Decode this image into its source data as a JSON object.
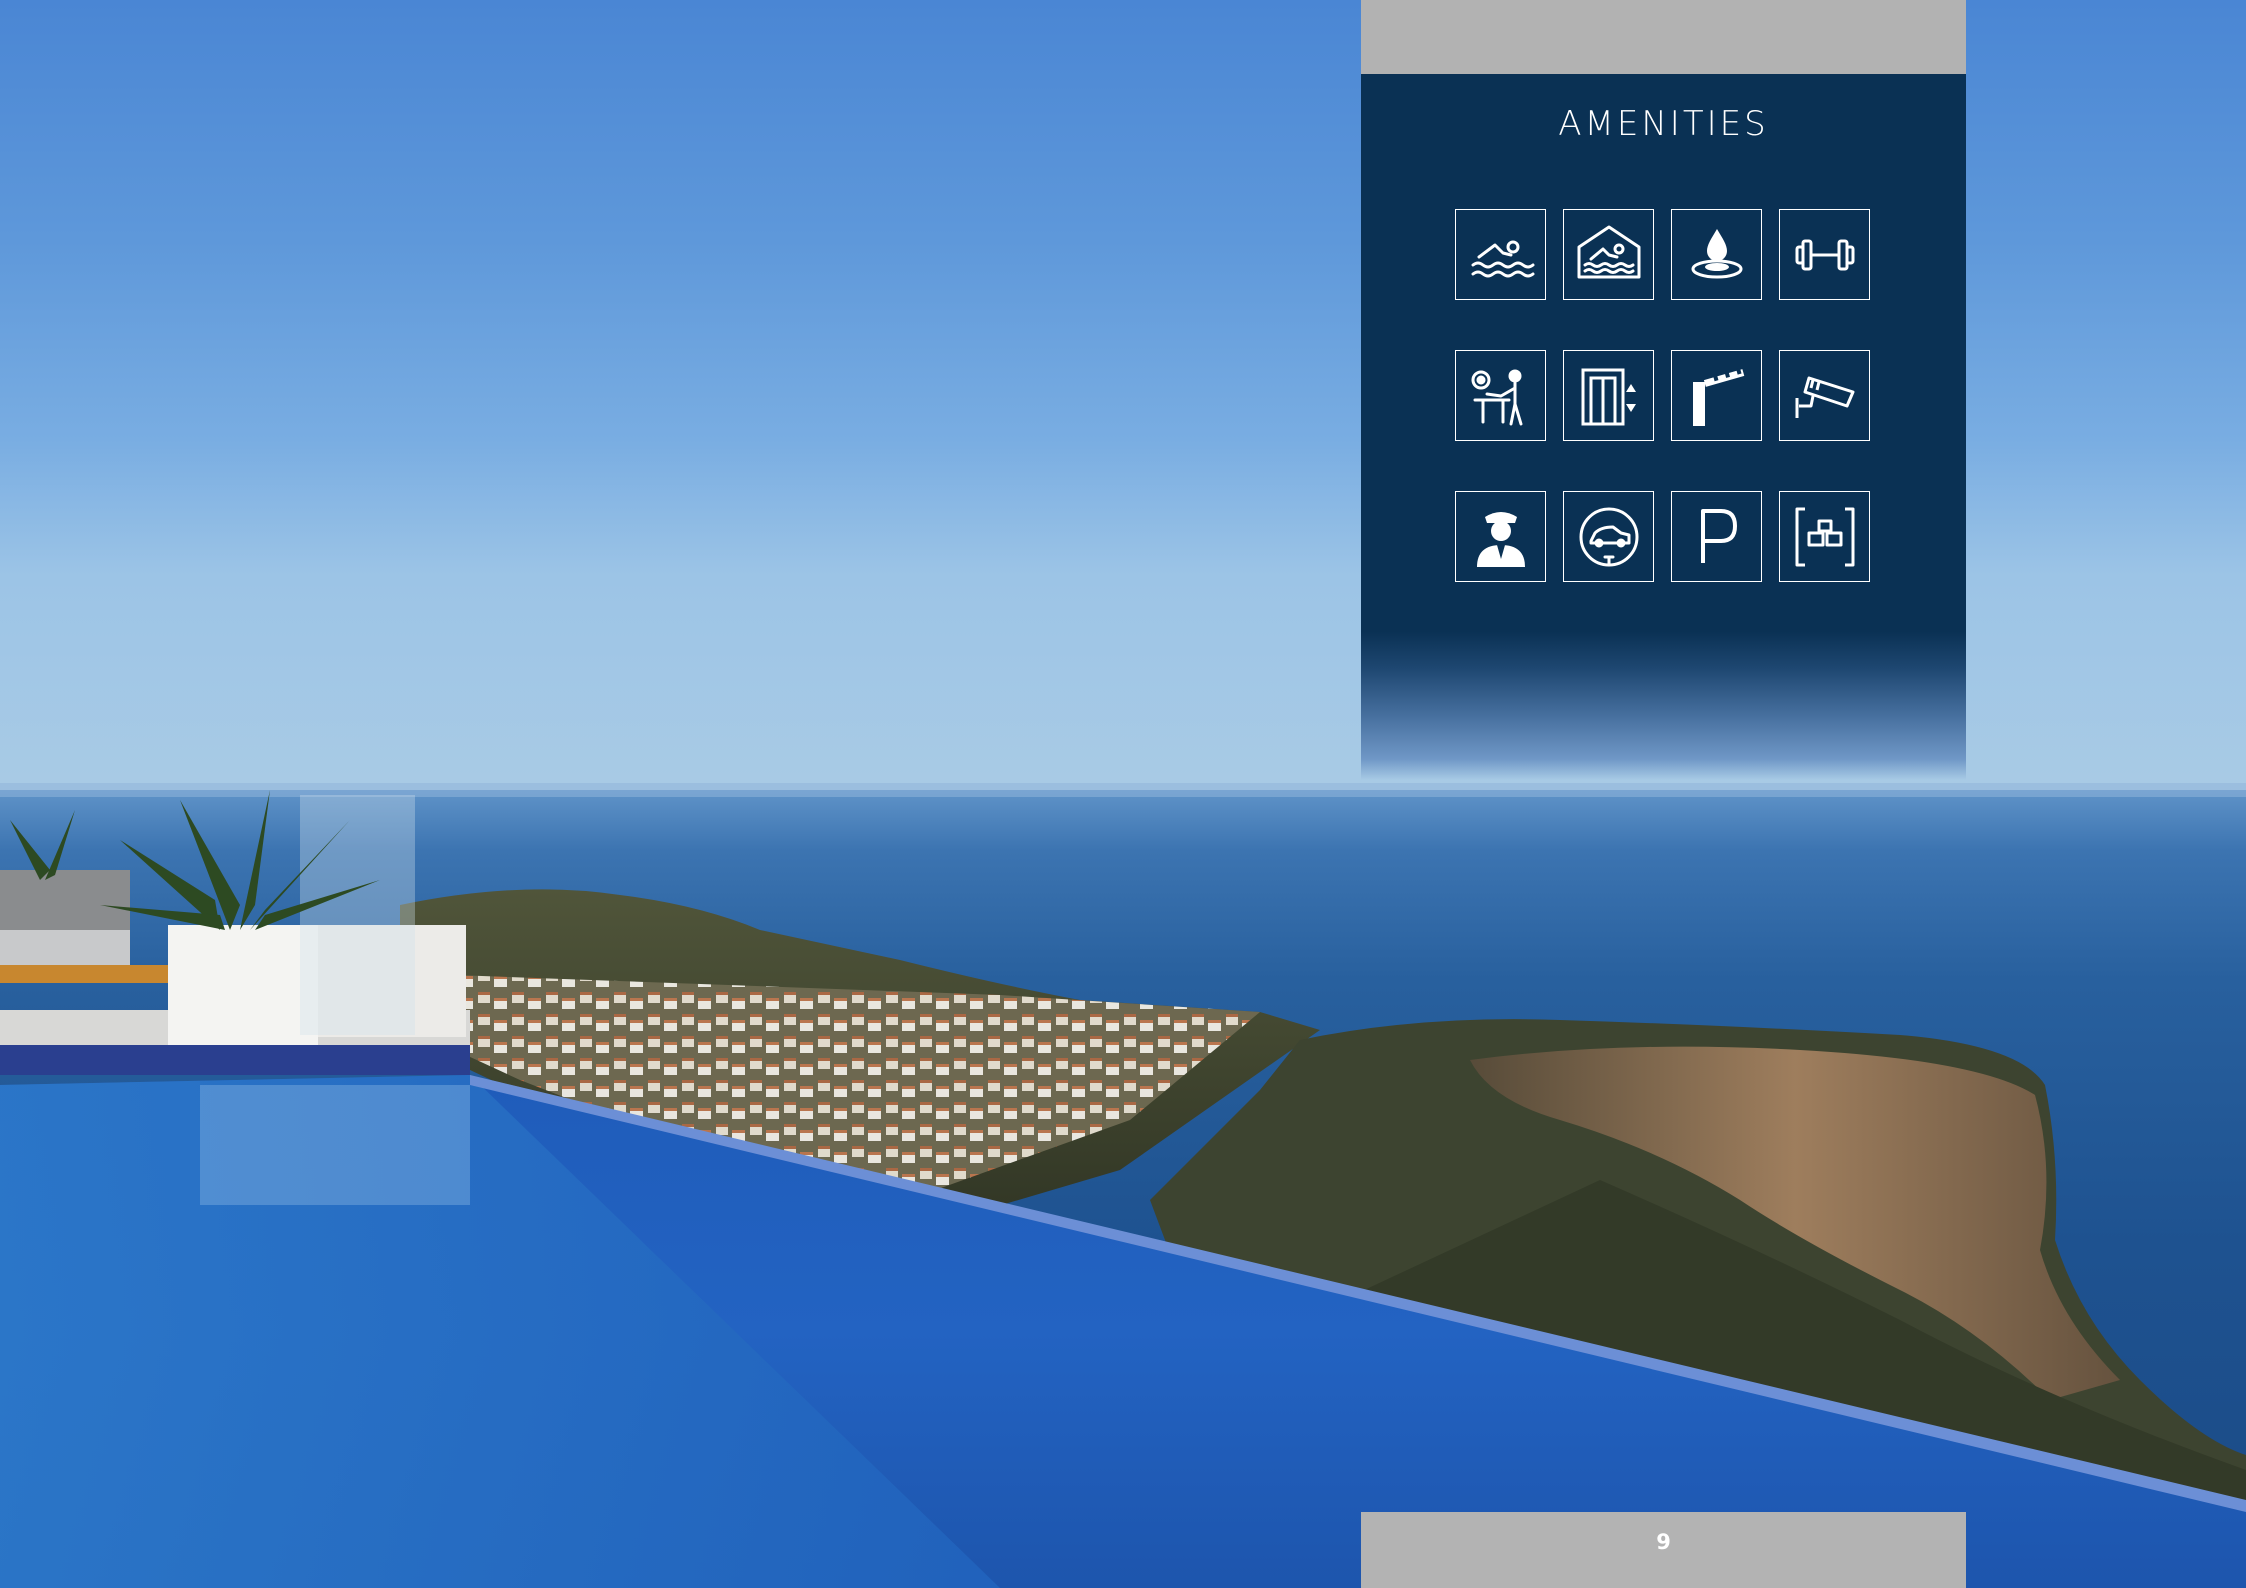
{
  "amenities": {
    "title": "AMENITIES",
    "icons": [
      {
        "icon": "outdoor-pool-icon"
      },
      {
        "icon": "indoor-pool-icon"
      },
      {
        "icon": "spa-icon"
      },
      {
        "icon": "gym-dumbbell-icon"
      },
      {
        "icon": "games-room-icon"
      },
      {
        "icon": "elevator-icon"
      },
      {
        "icon": "barrier-gate-icon"
      },
      {
        "icon": "security-camera-icon"
      },
      {
        "icon": "concierge-icon"
      },
      {
        "icon": "ev-charging-icon"
      },
      {
        "icon": "parking-icon"
      },
      {
        "icon": "storage-room-icon"
      }
    ]
  },
  "footer": {
    "page_number": "9"
  },
  "colors": {
    "panel_navy": "#0a3154",
    "panel_grey": "#b2b2b2",
    "icon_white": "#ffffff"
  }
}
